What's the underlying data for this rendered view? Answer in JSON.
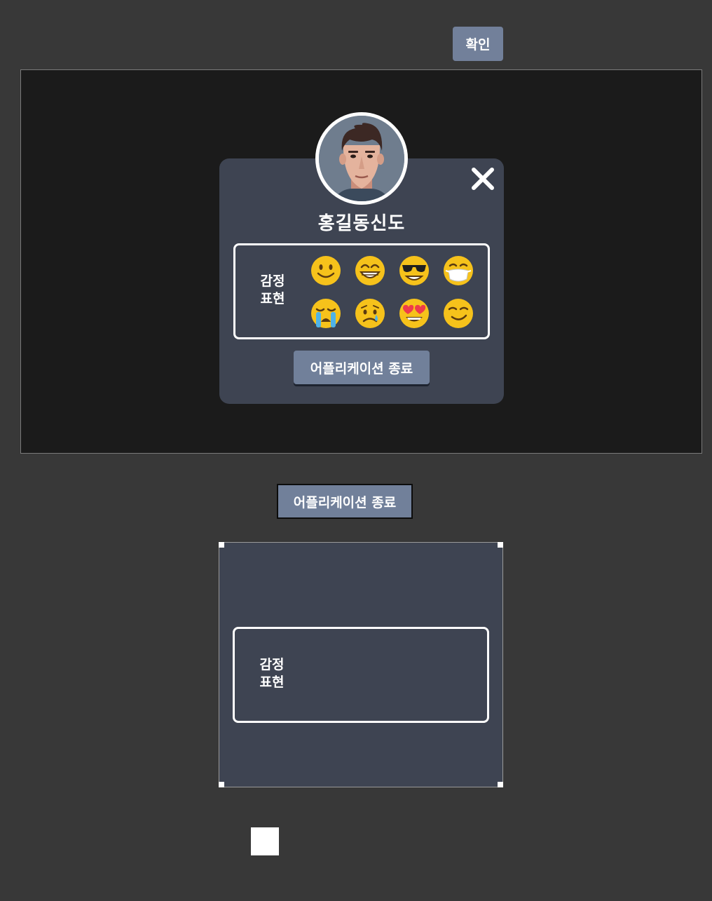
{
  "confirm_button": {
    "label": "확인"
  },
  "profile": {
    "name": "홍길동신도",
    "avatar_icon": "avatar-man-3d",
    "close_icon": "close-x-icon"
  },
  "emotion": {
    "label_line1": "감정",
    "label_line2": "표현",
    "emojis": [
      "smiling-face",
      "grinning-face",
      "sunglasses-face",
      "mask-face",
      "crying-face",
      "sad-tear-face",
      "heart-eyes-face",
      "smirking-face"
    ]
  },
  "exit_button": {
    "label": "어플리케이션 종료"
  },
  "colors": {
    "background": "#383838",
    "preview_bg": "#1b1b1b",
    "modal_bg": "#3e4452",
    "button_bg": "#71809a",
    "emoji_yellow": "#f6c21b"
  }
}
